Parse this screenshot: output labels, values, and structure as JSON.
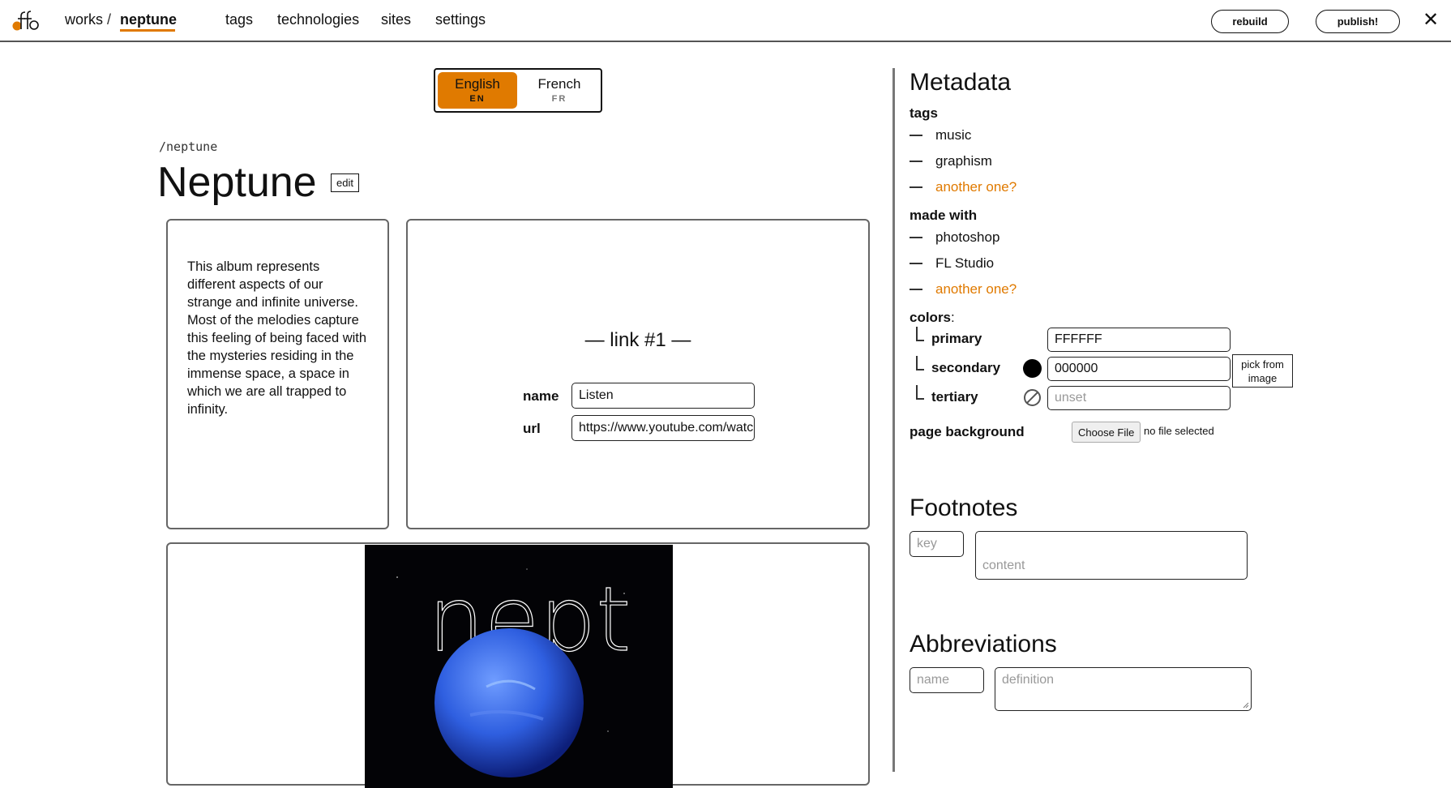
{
  "nav": {
    "breadcrumb_works": "works",
    "breadcrumb_separator": "/",
    "breadcrumb_current": "neptune",
    "tags": "tags",
    "technologies": "technologies",
    "sites": "sites",
    "settings": "settings",
    "rebuild": "rebuild",
    "publish": "publish!",
    "close": "✕"
  },
  "languages": [
    {
      "name": "English",
      "code": "EN",
      "selected": true
    },
    {
      "name": "French",
      "code": "FR",
      "selected": false
    }
  ],
  "work": {
    "slug": "/neptune",
    "title": "Neptune",
    "edit_label": "edit",
    "description": "This album represents different aspects of our strange and infinite universe. Most of the melodies capture this feeling of being faced with the mysteries residing in the immense space, a space in which we are all trapped to infinity.",
    "link": {
      "heading": "— link #1 —",
      "name_label": "name",
      "name_value": "Listen",
      "url_label": "url",
      "url_value": "https://www.youtube.com/watch"
    },
    "cover_text": "nept"
  },
  "metadata": {
    "title": "Metadata",
    "tags_label": "tags",
    "tags": [
      "music",
      "graphism"
    ],
    "tags_add": "another one?",
    "made_with_label": "made with",
    "made_with": [
      "photoshop",
      "FL Studio"
    ],
    "made_with_add": "another one?",
    "colors_label": "colors",
    "colors_colon": ":",
    "colors": {
      "primary_label": "primary",
      "primary_value": "FFFFFF",
      "secondary_label": "secondary",
      "secondary_value": "000000",
      "tertiary_label": "tertiary",
      "tertiary_placeholder": "unset"
    },
    "pick_from_image": "pick from image",
    "page_background_label": "page background",
    "choose_file": "Choose File",
    "file_status": "no file selected"
  },
  "footnotes": {
    "title": "Footnotes",
    "key_placeholder": "key",
    "content_placeholder": "content"
  },
  "abbreviations": {
    "title": "Abbreviations",
    "name_placeholder": "name",
    "definition_placeholder": "definition"
  },
  "colors": {
    "accent": "#e07a00",
    "secondary_swatch": "#000000"
  }
}
